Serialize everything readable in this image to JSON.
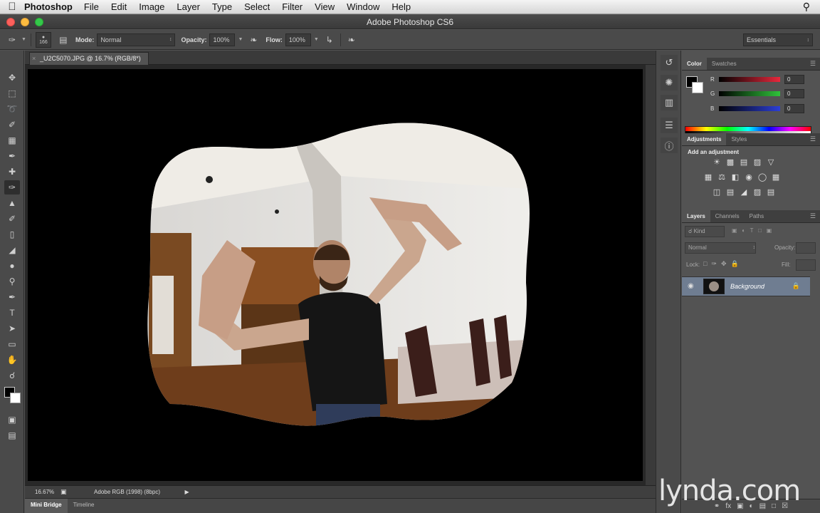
{
  "menubar": {
    "app": "Photoshop",
    "menus": [
      "File",
      "Edit",
      "Image",
      "Layer",
      "Type",
      "Select",
      "Filter",
      "View",
      "Window",
      "Help"
    ]
  },
  "window": {
    "title": "Adobe Photoshop CS6"
  },
  "options": {
    "brush_size": "166",
    "mode_label": "Mode:",
    "mode_value": "Normal",
    "opacity_label": "Opacity:",
    "opacity_value": "100%",
    "flow_label": "Flow:",
    "flow_value": "100%",
    "workspace": "Essentials"
  },
  "document": {
    "tab_title": "_U2C5070.JPG @ 16.7% (RGB/8*)",
    "status_zoom": "16.67%",
    "status_info": "Adobe RGB (1998) (8bpc)"
  },
  "bottom_tabs": [
    "Mini Bridge",
    "Timeline"
  ],
  "color_panel": {
    "tabs": [
      "Color",
      "Swatches"
    ],
    "channels": [
      {
        "label": "R",
        "value": "0"
      },
      {
        "label": "G",
        "value": "0"
      },
      {
        "label": "B",
        "value": "0"
      }
    ],
    "colors": {
      "red": "#e8283c",
      "green": "#2fc23a",
      "blue": "#2c3fd6"
    }
  },
  "adjustments_panel": {
    "tabs": [
      "Adjustments",
      "Styles"
    ],
    "title": "Add an adjustment"
  },
  "layers_panel": {
    "tabs": [
      "Layers",
      "Channels",
      "Paths"
    ],
    "kind": "Kind",
    "blend": "Normal",
    "opacity_label": "Opacity:",
    "lock_label": "Lock:",
    "fill_label": "Fill:",
    "layer_name": "Background"
  },
  "watermark": "lynda.com"
}
